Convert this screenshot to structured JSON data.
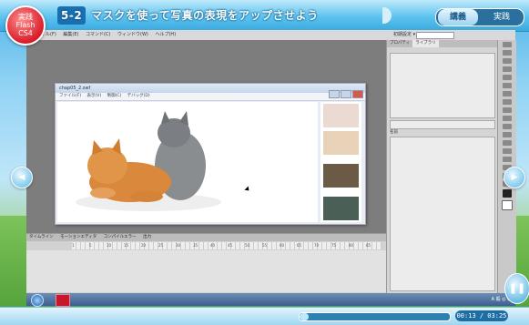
{
  "header": {
    "logo_lines": [
      "実践",
      "Flash",
      "CS4"
    ],
    "lesson_number": "5-2",
    "lesson_title": "マスクを使って写真の表現をアップさせよう",
    "tabs": [
      "講義",
      "実践"
    ],
    "active_tab": "講義"
  },
  "flash_menu": {
    "items": [
      "ファイル(F)",
      "編集(E)",
      "コマンド(C)",
      "ウィンドウ(W)",
      "ヘルプ(H)"
    ],
    "workspace": "初期設定 ▾"
  },
  "swf_window": {
    "title": "chap05_2.swf",
    "menu": [
      "ファイル(F)",
      "表示(V)",
      "制御(C)",
      "デバッグ(D)"
    ]
  },
  "right_panel": {
    "tabs": [
      "プロパティ",
      "ライブラリ"
    ],
    "active_tab": "ライブラリ",
    "section_label": "名前"
  },
  "timeline": {
    "tabs": [
      "タイムライン",
      "モーションエディタ",
      "コンパイルエラー",
      "出力"
    ],
    "ruler": [
      "1",
      "5",
      "10",
      "15",
      "20",
      "25",
      "30",
      "35",
      "40",
      "45",
      "50",
      "55",
      "60",
      "65",
      "70",
      "75",
      "80",
      "85"
    ]
  },
  "taskbar": {
    "tray_text": "A 般 ◎ ◇"
  },
  "playback": {
    "time": "00:13 / 03:25",
    "progress": 0.06
  },
  "colors": {
    "accent": "#3aa9df",
    "logo": "#d81d2a"
  }
}
